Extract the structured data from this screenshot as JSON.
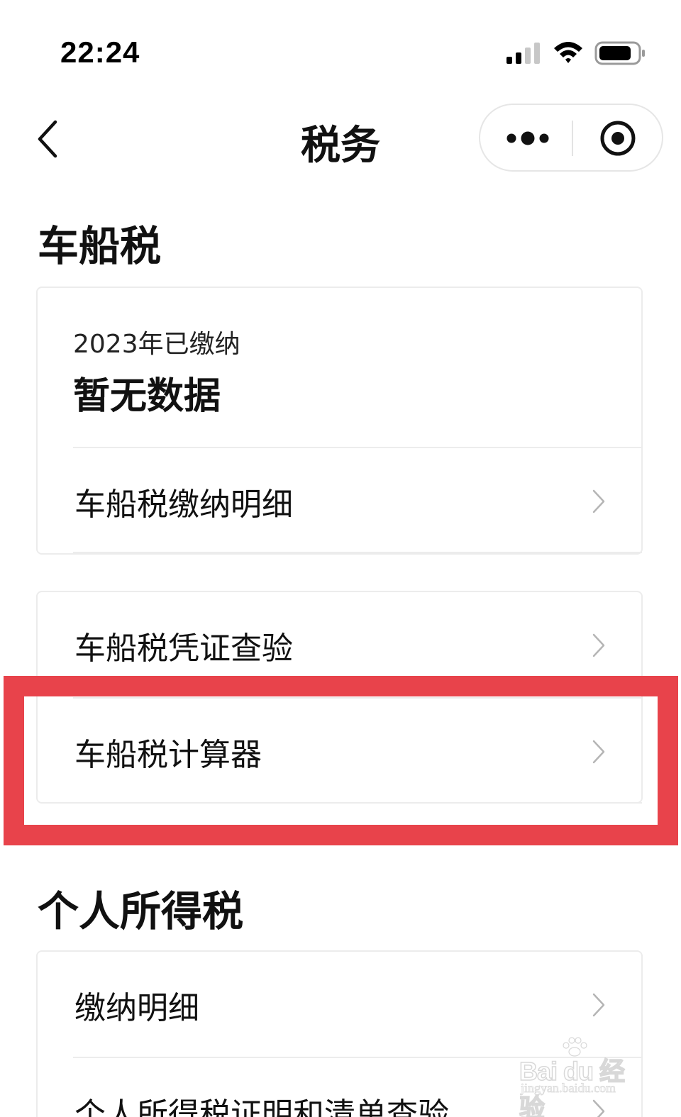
{
  "status_bar": {
    "time": "22:24",
    "icons": [
      "signal-icon",
      "wifi-icon",
      "battery-icon"
    ]
  },
  "nav": {
    "title": "税务",
    "back_icon": "chevron-left-icon",
    "more_icon": "more-dots-icon",
    "close_icon": "target-circle-icon"
  },
  "vehicle_tax": {
    "heading": "车船税",
    "summary": {
      "year_label": "2023年已缴纳",
      "value": "暂无数据"
    },
    "rows": [
      {
        "label": "车船税缴纳明细"
      },
      {
        "label": "车船税凭证查验"
      },
      {
        "label": "车船税计算器"
      }
    ]
  },
  "personal_tax": {
    "heading": "个人所得税",
    "rows": [
      {
        "label": "缴纳明细"
      },
      {
        "label": "个人所得税证明和清单查验"
      }
    ]
  },
  "watermark": {
    "logo": "Bai du 经验",
    "url": "jingyan.baidu.com"
  },
  "colors": {
    "highlight": "#e8434b",
    "divider": "#ececec",
    "chevron": "#b5b5b5"
  }
}
